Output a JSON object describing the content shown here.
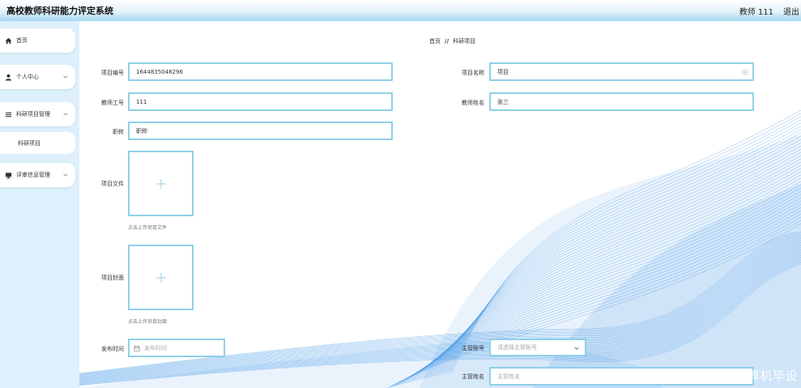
{
  "header": {
    "app_title": "高校教师科研能力评定系统",
    "user": "教师 111",
    "logout": "退出"
  },
  "sidebar": {
    "items": [
      {
        "label": "首页",
        "icon": "home-icon"
      },
      {
        "label": "个人中心",
        "icon": "user-icon"
      },
      {
        "label": "科研项目管理",
        "icon": "list-icon"
      },
      {
        "label": "科研项目",
        "icon": ""
      },
      {
        "label": "评审信息管理",
        "icon": "monitor-icon"
      }
    ]
  },
  "breadcrumb": {
    "home": "首页",
    "separator": "//",
    "current": "科研项目"
  },
  "form": {
    "project_no": {
      "label": "项目编号",
      "value": "1644835048296"
    },
    "project_name": {
      "label": "项目名称",
      "value": "项目"
    },
    "teacher_no": {
      "label": "教师工号",
      "value": "111"
    },
    "teacher_name": {
      "label": "教师姓名",
      "value": "张三"
    },
    "title": {
      "label": "职称",
      "value": "职称"
    },
    "project_file": {
      "label": "项目文件",
      "tip": "点击上传项目文件"
    },
    "project_cover": {
      "label": "项目封面",
      "tip": "点击上传项目封面"
    },
    "publish_time": {
      "label": "发布时间",
      "placeholder": "发布时间"
    },
    "manager_account": {
      "label": "主管账号",
      "placeholder": "请选择主管账号"
    },
    "manager_name": {
      "label": "主管姓名",
      "placeholder": "主管姓名"
    }
  },
  "watermark": "CSDN @畔云计算机毕设",
  "colors": {
    "accent_border": "#8fd0e8",
    "sidebar_bg": "#ddf0fb",
    "wave": "#2f8de4"
  }
}
